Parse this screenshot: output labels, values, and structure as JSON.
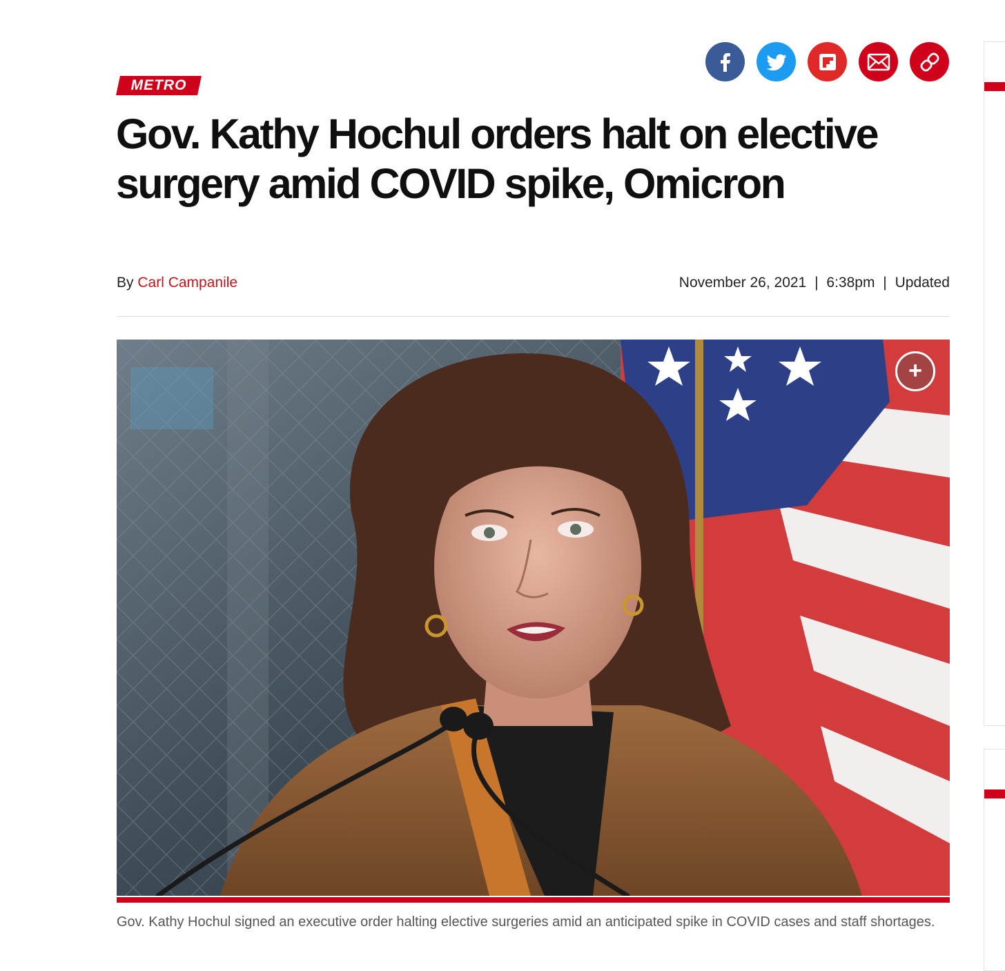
{
  "share": {
    "facebook_icon": "facebook-icon",
    "twitter_icon": "twitter-icon",
    "flipboard_icon": "flipboard-icon",
    "email_icon": "email-icon",
    "link_icon": "link-icon"
  },
  "article": {
    "section": "METRO",
    "headline": "Gov. Kathy Hochul orders halt on elective surgery amid COVID spike, Omicron",
    "byline_prefix": "By",
    "author": "Carl Campanile",
    "date": "November 26, 2021",
    "date_sep_1": "|",
    "time": "6:38pm",
    "date_sep_2": "|",
    "updated_label": "Updated"
  },
  "photo": {
    "expand_label": "+",
    "caption": "Gov. Kathy Hochul signed an executive order halting elective surgeries amid an anticipated spike in COVID cases and staff shortages."
  },
  "colors": {
    "brand_red": "#d0021b",
    "link_red": "#c4141b",
    "facebook": "#3a5a98",
    "twitter": "#1d9bf0"
  }
}
